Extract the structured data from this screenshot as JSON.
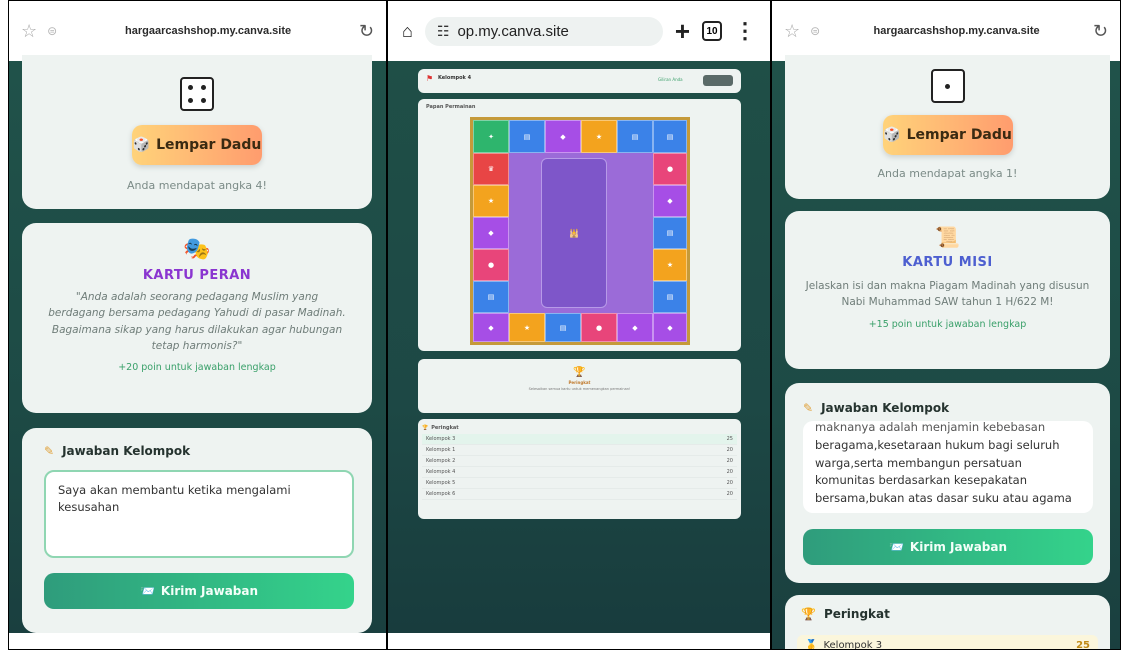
{
  "screen1": {
    "address_bar": {
      "url": "hargaarcashshop.my.canva.site"
    },
    "dice_card": {
      "button_label": "Lempar Dadu",
      "result_text": "Anda mendapat angka 4!"
    },
    "role_card": {
      "title": "KARTU PERAN",
      "quote": "\"Anda adalah seorang pedagang Muslim yang berdagang bersama pedagang Yahudi di pasar Madinah. Bagaimana sikap yang harus dilakukan agar hubungan tetap harmonis?\"",
      "points": "+20 poin untuk jawaban lengkap"
    },
    "answer_card": {
      "title": "Jawaban Kelompok",
      "answer": "Saya akan membantu ketika mengalami kesusahan",
      "submit_label": "Kirim Jawaban"
    }
  },
  "screen2": {
    "address_bar": {
      "url": "op.my.canva.site",
      "tab_count": "10"
    },
    "header": {
      "group": "Kelompok 4",
      "badge": "Giliran Anda"
    },
    "board": {
      "title": "Papan Permainan"
    },
    "winner": {
      "title": "Peringkat",
      "subtitle": "Selesaikan semua kartu untuk memenangkan permainan!"
    },
    "ranking": {
      "title": "Peringkat",
      "rows": [
        {
          "name": "Kelompok 3",
          "score": "25"
        },
        {
          "name": "Kelompok 1",
          "score": "20"
        },
        {
          "name": "Kelompok 2",
          "score": "20"
        },
        {
          "name": "Kelompok 4",
          "score": "20"
        },
        {
          "name": "Kelompok 5",
          "score": "20"
        },
        {
          "name": "Kelompok 6",
          "score": "20"
        }
      ]
    }
  },
  "screen3": {
    "address_bar": {
      "url": "hargaarcashshop.my.canva.site"
    },
    "dice_card": {
      "button_label": "Lempar Dadu",
      "result_text": "Anda mendapat angka 1!"
    },
    "mission_card": {
      "title": "KARTU MISI",
      "text": "Jelaskan isi dan makna Piagam Madinah yang disusun Nabi Muhammad SAW tahun 1 H/622 M!",
      "points": "+15 poin untuk jawaban lengkap"
    },
    "answer_card": {
      "title": "Jawaban Kelompok",
      "answer_partial": "maknanya adalah menjamin kebebasan",
      "answer": "beragama,kesetaraan hukum bagi seluruh warga,serta membangun persatuan komunitas berdasarkan kesepakatan bersama,bukan atas dasar suku atau agama",
      "submit_label": "Kirim Jawaban"
    },
    "ranking": {
      "title": "Peringkat",
      "first_row": {
        "name": "Kelompok 3",
        "score": "25"
      }
    }
  },
  "colors": {
    "teal_bg": "#1f4f47",
    "card": "#eef3f1",
    "accent_green": "#34d38b",
    "accent_orange": "#ff9c6e",
    "role_purple": "#8a35d0",
    "mission_blue": "#4d5fd0"
  }
}
